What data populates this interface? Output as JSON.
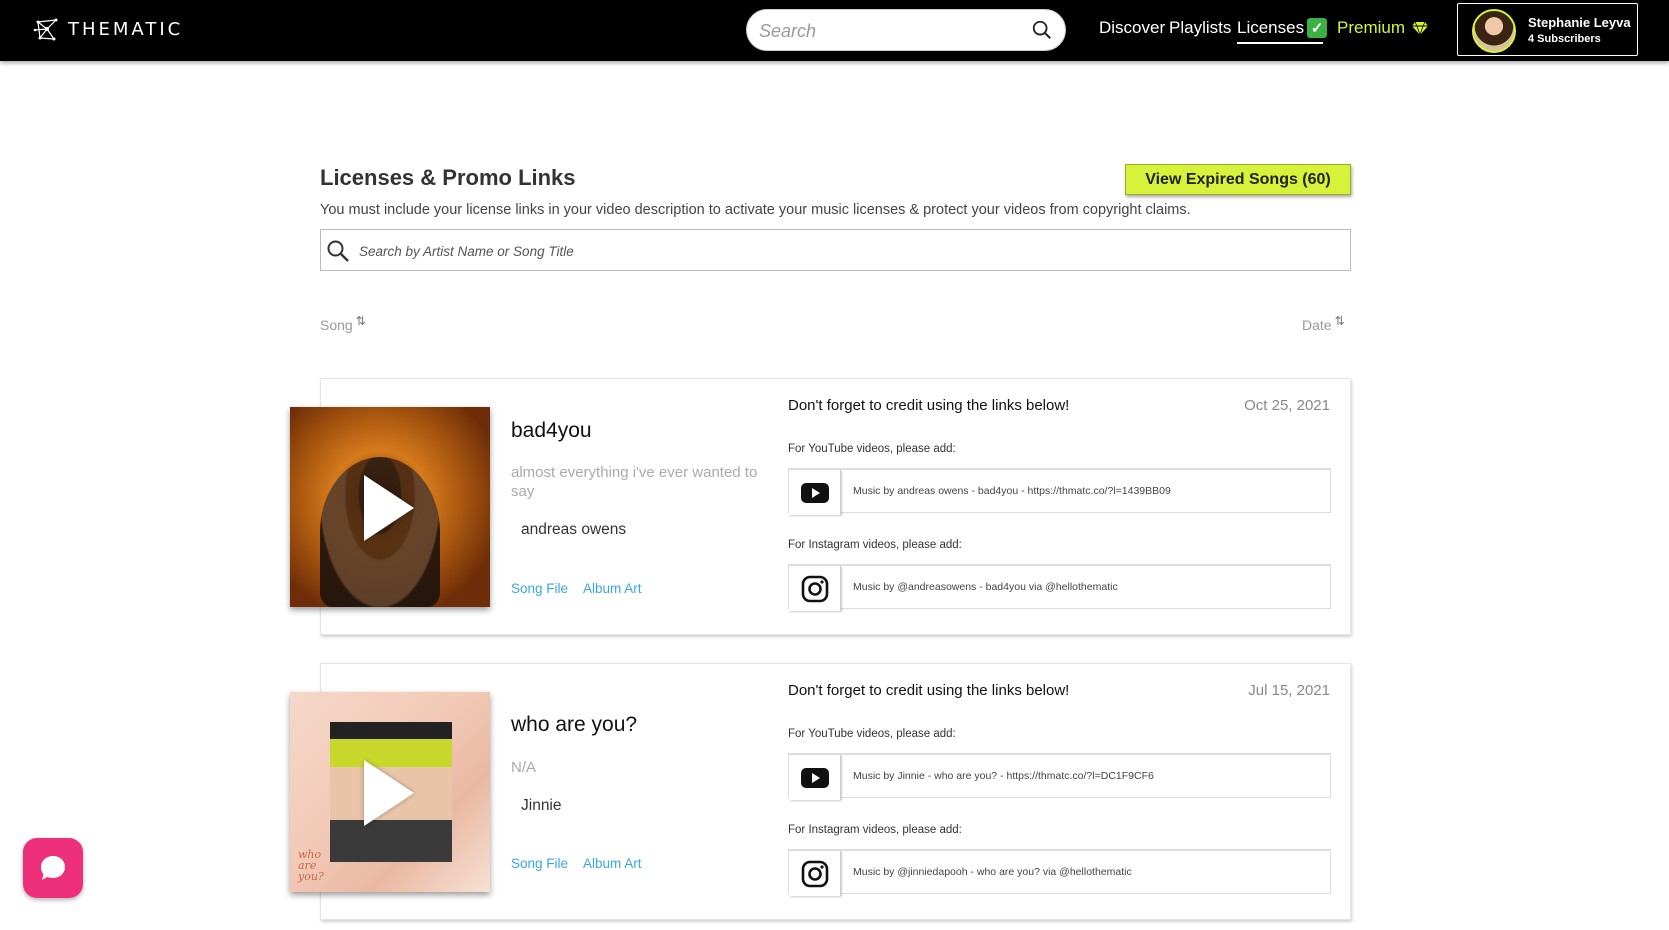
{
  "header": {
    "logo_text": "THEMATIC",
    "search_placeholder": "Search",
    "nav": {
      "discover": "Discover",
      "playlists": "Playlists",
      "licenses": "Licenses",
      "premium": "Premium"
    },
    "user": {
      "name": "Stephanie Leyva",
      "subscribers": "4 Subscribers"
    }
  },
  "colors": {
    "accent": "#d7f23a",
    "link": "#3aa7e0",
    "chat": "#ee2f79"
  },
  "main": {
    "title": "Licenses & Promo Links",
    "expired_button": "View Expired Songs (60)",
    "description": "You must include your license links in your video description to activate your music licenses & protect your videos from copyright claims.",
    "search_placeholder": "Search by Artist Name or Song Title",
    "sort": {
      "song": "Song",
      "date": "Date",
      "arrows": "⇅"
    }
  },
  "licenses": [
    {
      "title": "bad4you",
      "subtitle": "almost everything i've ever wanted to say",
      "artist": "andreas owens",
      "song_file": "Song File",
      "album_art": "Album Art",
      "credit_heading": "Don't forget to credit using the links below!",
      "date": "Oct 25, 2021",
      "youtube_label": "For YouTube videos, please add:",
      "youtube_text": "Music by andreas owens - bad4you - https://thmatc.co/?l=1439BB09",
      "instagram_label": "For Instagram videos, please add:",
      "instagram_text": "Music by @andreasowens - bad4you via @hellothematic"
    },
    {
      "title": "who are you?",
      "subtitle": "N/A",
      "artist": "Jinnie",
      "song_file": "Song File",
      "album_art": "Album Art",
      "cover_text": "who are you?",
      "credit_heading": "Don't forget to credit using the links below!",
      "date": "Jul 15, 2021",
      "youtube_label": "For YouTube videos, please add:",
      "youtube_text": "Music by Jinnie - who are you? - https://thmatc.co/?l=DC1F9CF6",
      "instagram_label": "For Instagram videos, please add:",
      "instagram_text": "Music by @jinniedapooh - who are you? via @hellothematic"
    }
  ]
}
